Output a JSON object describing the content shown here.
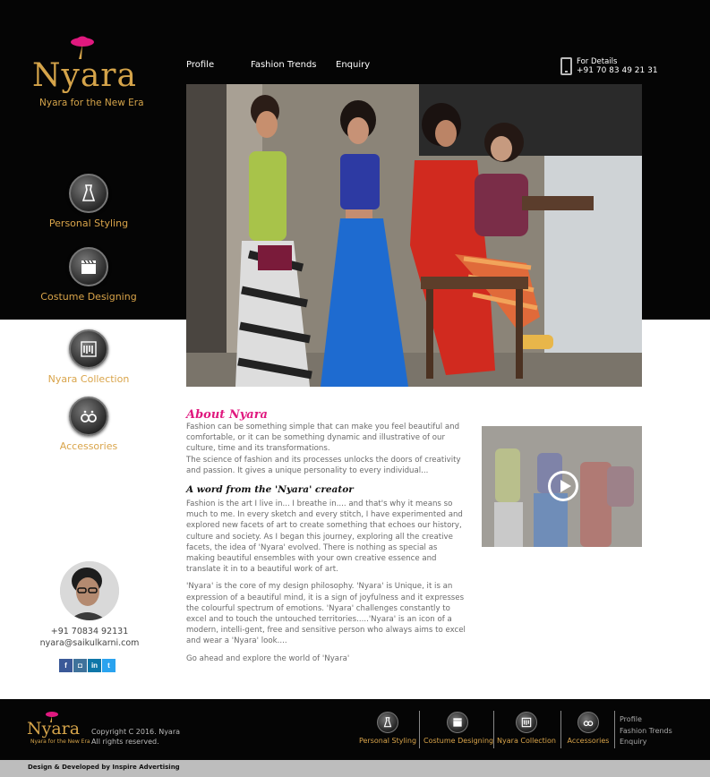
{
  "brand": {
    "name": "Nyara",
    "tagline": "Nyara for the New Era"
  },
  "nav": [
    {
      "label": "Profile"
    },
    {
      "label": "Fashion Trends"
    },
    {
      "label": "Enquiry"
    }
  ],
  "contact": {
    "label": "For Details",
    "phone": "+91 70 83 49 21 31"
  },
  "side_menu": [
    {
      "label": "Personal Styling",
      "icon": "dress-icon"
    },
    {
      "label": "Costume Designing",
      "icon": "clapperboard-icon"
    },
    {
      "label": "Nyara Collection",
      "icon": "clothes-rack-icon"
    },
    {
      "label": "Accessories",
      "icon": "earrings-icon"
    }
  ],
  "about": {
    "title": "About Nyara",
    "p1": "Fashion can be something simple that can make you feel beautiful and comfortable, or it can be something dynamic and illustrative of our culture, time and its transformations.",
    "p2": "The science of fashion and its processes unlocks the doors of creativity and passion. It gives a unique personality to every individual...",
    "creator_heading": "A word from the 'Nyara' creator",
    "p3": "Fashion is the art I live in... I breathe in.... and that's why it means so much to me. In every sketch and every stitch, I have experimented and explored new facets of art to create something that echoes our history, culture and society. As I began this journey, exploring all the creative facets, the idea of 'Nyara' evolved. There is nothing as special as making beautiful ensembles with your own creative essence and translate it in to a beautiful work of art.",
    "p4": " 'Nyara' is the core of my design philosophy. 'Nyara' is Unique, it is an expression of a beautiful mind, it is a sign of joyfulness and it expresses the colourful spectrum of emotions. 'Nyara' challenges constantly to excel and to touch the untouched territories.....'Nyara' is an icon of a modern, intelli-gent, free and sensitive person who always aims to excel and wear a 'Nyara' look....",
    "p5": "Go ahead and explore the world of 'Nyara'"
  },
  "profile": {
    "phone": "+91 70834 92131",
    "email": "nyara@saikulkarni.com"
  },
  "social": [
    {
      "label": "f",
      "icon": "facebook-icon",
      "color": "#3b5998"
    },
    {
      "label": "◘",
      "icon": "instagram-icon",
      "color": "#3f729b"
    },
    {
      "label": "in",
      "icon": "linkedin-icon",
      "color": "#0e76a8"
    },
    {
      "label": "t",
      "icon": "twitter-icon",
      "color": "#2aa3ef"
    }
  ],
  "footer": {
    "brand": "Nyara",
    "tagline": "Nyara for the New Era",
    "copyright_line1": "Copyright C 2016. Nyara",
    "copyright_line2": "All rights reserved.",
    "items": [
      {
        "label": "Personal Styling"
      },
      {
        "label": "Costume Designing"
      },
      {
        "label": "Nyara Collection"
      },
      {
        "label": "Accessories"
      }
    ],
    "links": [
      {
        "label": "Profile"
      },
      {
        "label": "Fashion Trends"
      },
      {
        "label": "Enquiry"
      }
    ],
    "credit": "Design & Developed by Inspire Advertising"
  },
  "colors": {
    "accent_gold": "#d9a44a",
    "accent_pink": "#e0197f",
    "background_dark": "#050505"
  }
}
